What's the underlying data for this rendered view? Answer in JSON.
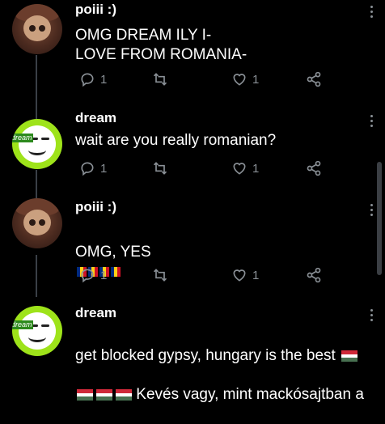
{
  "comments": [
    {
      "username": "poiii :)",
      "avatar": "poiii",
      "text": "OMG DREAM ILY I-\nLOVE FROM ROMANIA-",
      "reply_count": "1",
      "like_count": "1"
    },
    {
      "username": "dream",
      "avatar": "dream",
      "avatar_tag": "dream",
      "text": "wait are you really romanian?",
      "reply_count": "1",
      "like_count": "1"
    },
    {
      "username": "poiii :)",
      "avatar": "poiii",
      "text": "OMG, YES",
      "reply_count": "1",
      "like_count": "1"
    },
    {
      "username": "dream",
      "avatar": "dream",
      "avatar_tag": "dream",
      "text_line1": "get blocked gypsy, hungary is the best",
      "text_line2": "Kevés vagy, mint mackósajtban a"
    }
  ],
  "icons": {
    "reply": "reply-bubble-icon",
    "retweet": "retweet-icon",
    "like": "heart-icon",
    "share": "share-icon",
    "more": "more-vertical-icon"
  },
  "colors": {
    "background": "#000000",
    "muted": "#8a9096",
    "dream_green": "#9ee31a",
    "thread_line": "#3a4047"
  }
}
